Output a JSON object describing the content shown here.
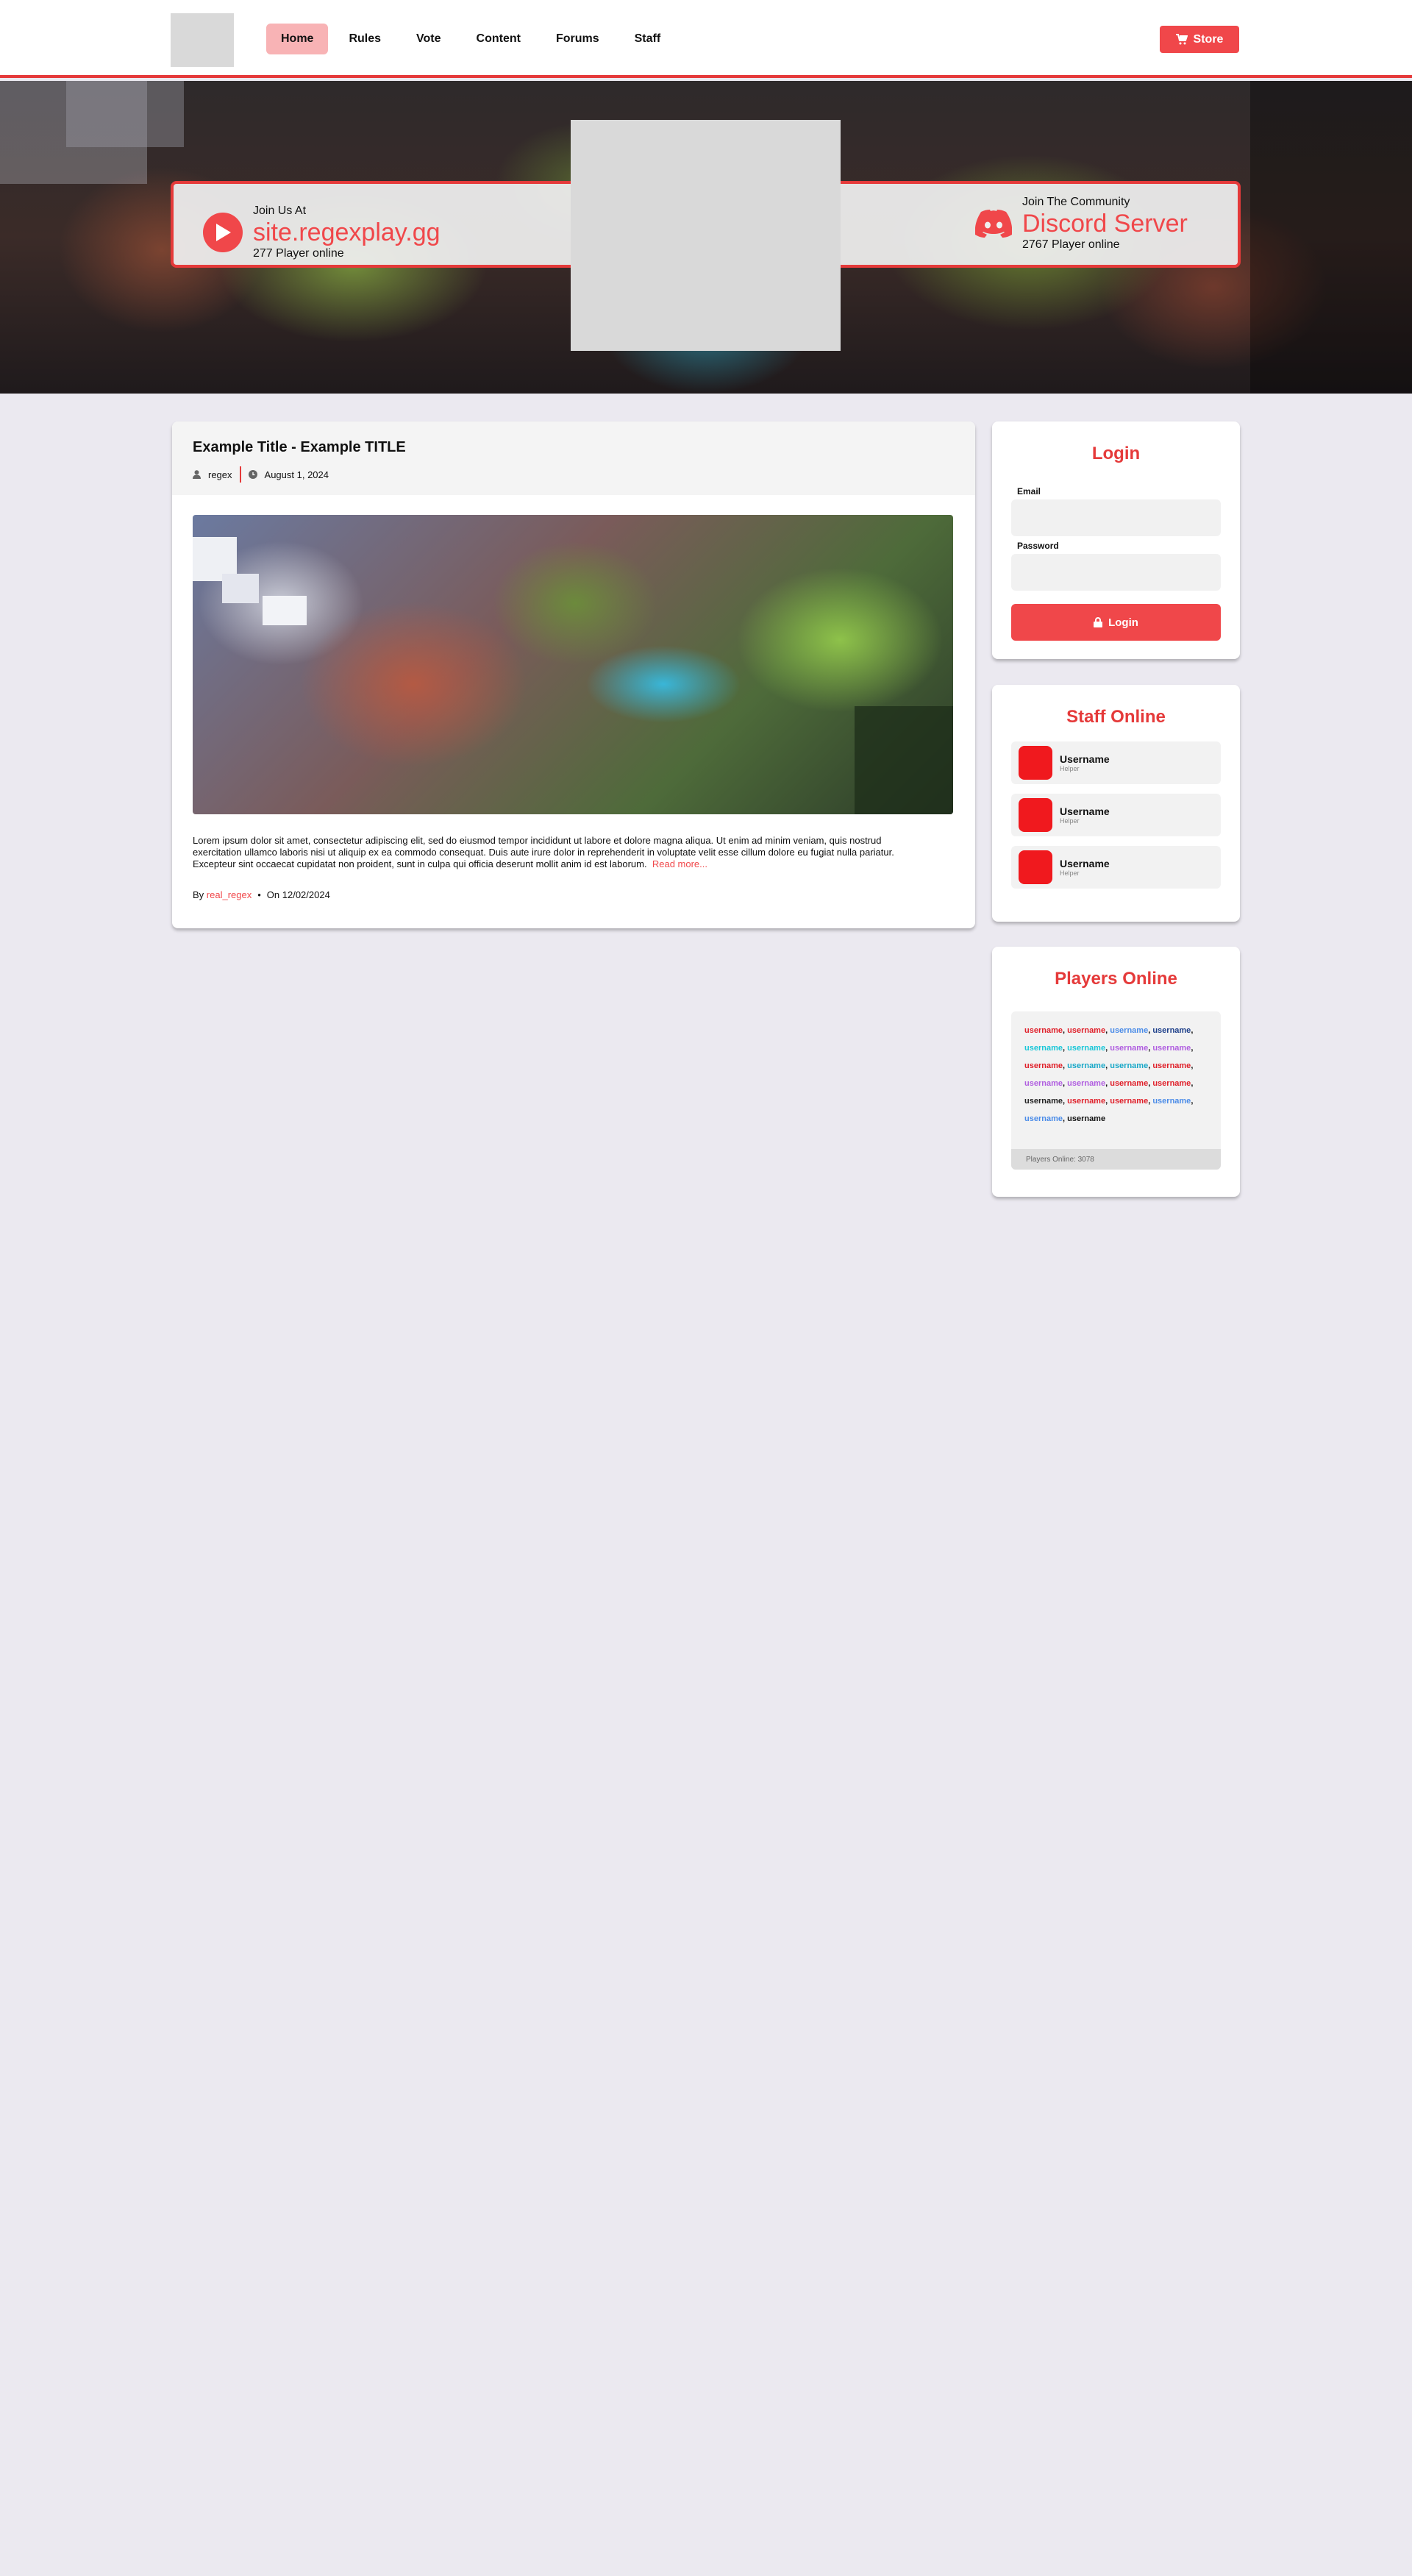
{
  "nav": {
    "items": [
      {
        "label": "Home",
        "active": true
      },
      {
        "label": "Rules"
      },
      {
        "label": "Vote"
      },
      {
        "label": "Content"
      },
      {
        "label": "Forums"
      },
      {
        "label": "Staff"
      }
    ],
    "store_label": "Store",
    "store_icon": "cart-icon"
  },
  "hero": {
    "left": {
      "label": "Join Us At",
      "address": "site.regexplay.gg",
      "players": "277 Player online",
      "icon": "play-icon"
    },
    "right": {
      "label": "Join The Community",
      "title": "Discord Server",
      "players": "2767 Player online",
      "icon": "discord-icon"
    }
  },
  "post": {
    "title": "Example Title - Example TITLE",
    "author": "regex",
    "date": "August 1, 2024",
    "body": "Lorem ipsum dolor sit amet, consectetur adipiscing elit, sed do eiusmod tempor incididunt ut labore et dolore magna aliqua. Ut enim ad minim veniam, quis nostrud exercitation ullamco laboris nisi ut aliquip ex ea commodo consequat. Duis aute irure dolor in reprehenderit in voluptate velit esse cillum dolore eu fugiat nulla pariatur. Excepteur sint occaecat cupidatat non proident, sunt in culpa qui officia deserunt mollit anim id est laborum.",
    "read_more": "Read more...",
    "footer_by": "By",
    "footer_author": "real_regex",
    "footer_bullet": "•",
    "footer_date": "On 12/02/2024"
  },
  "login": {
    "title": "Login",
    "email_label": "Email",
    "password_label": "Password",
    "button": "Login"
  },
  "staff": {
    "title": "Staff Online",
    "members": [
      {
        "name": "Username",
        "role": "Helper"
      },
      {
        "name": "Username",
        "role": "Helper"
      },
      {
        "name": "Username",
        "role": "Helper"
      }
    ]
  },
  "players": {
    "title": "Players Online",
    "names": [
      {
        "name": "username",
        "color": "#e0202a"
      },
      {
        "name": "username",
        "color": "#e0202a"
      },
      {
        "name": "username",
        "color": "#4b8ce8"
      },
      {
        "name": "username",
        "color": "#1d3f8a"
      },
      {
        "name": "username",
        "color": "#19c7d8"
      },
      {
        "name": "username",
        "color": "#19c7d8"
      },
      {
        "name": "username",
        "color": "#b05ee0"
      },
      {
        "name": "username",
        "color": "#b05ee0"
      },
      {
        "name": "username",
        "color": "#e0202a"
      },
      {
        "name": "username",
        "color": "#19a8c8"
      },
      {
        "name": "username",
        "color": "#19a8c8"
      },
      {
        "name": "username",
        "color": "#e0202a"
      },
      {
        "name": "username",
        "color": "#b05ee0"
      },
      {
        "name": "username",
        "color": "#b05ee0"
      },
      {
        "name": "username",
        "color": "#e0202a"
      },
      {
        "name": "username",
        "color": "#e0202a"
      },
      {
        "name": "username",
        "color": "#222222"
      },
      {
        "name": "username",
        "color": "#e0202a"
      },
      {
        "name": "username",
        "color": "#e0202a"
      },
      {
        "name": "username",
        "color": "#4b8ce8"
      },
      {
        "name": "username",
        "color": "#4b8ce8"
      },
      {
        "name": "username",
        "color": "#111111"
      }
    ],
    "footer": "Players Online: 3078"
  },
  "colors": {
    "accent": "#f0474a",
    "background": "#ebe9f0"
  }
}
